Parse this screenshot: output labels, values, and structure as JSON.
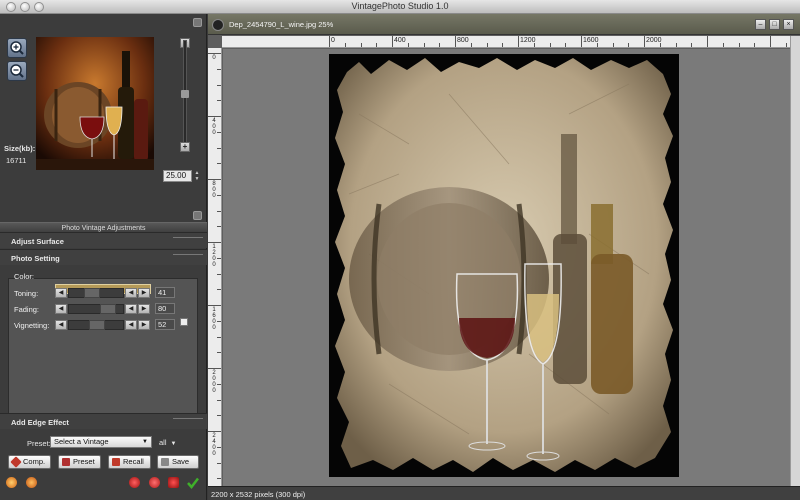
{
  "window": {
    "title": "VintagePhoto Studio 1.0"
  },
  "navigator": {
    "size_label": "Size(kb):",
    "size_value": "16711",
    "zoom_value": "25.00",
    "zoom_minus": "−",
    "zoom_plus": "+"
  },
  "adjust": {
    "panel_title": "Photo Vintage Adjustments",
    "adjust_surface": "Adjust Surface",
    "photo_setting": "Photo Setting",
    "color_label": "Color:",
    "color_value": "#b59a58",
    "sliders": [
      {
        "label": "Toning:",
        "value": "41",
        "fraction": 0.41
      },
      {
        "label": "Fading:",
        "value": "80",
        "fraction": 0.8
      },
      {
        "label": "Vignetting:",
        "value": "52",
        "fraction": 0.52
      }
    ],
    "add_edge_effect": "Add Edge Effect",
    "preset_label": "Preset:",
    "preset_value": "Select a Vintage",
    "filter_value": "all"
  },
  "buttons": {
    "comp": "Comp.",
    "preset": "Preset",
    "recall": "Recall",
    "save": "Save"
  },
  "document": {
    "tab_title": "Dep_2454790_L_wine.jpg 25%",
    "status": "2200 x 2532 pixels (300 dpi)"
  },
  "ruler": {
    "h_labels": [
      "0",
      "400",
      "800",
      "1200",
      "1600",
      "2000"
    ],
    "v_labels": [
      "0",
      "400",
      "800",
      "1200",
      "1600",
      "2000",
      "2400"
    ]
  },
  "colors": {
    "accent_sepia": "#b59a58",
    "tab_olive": "#6b6c5a",
    "panel_dark": "#3c3c3c"
  }
}
